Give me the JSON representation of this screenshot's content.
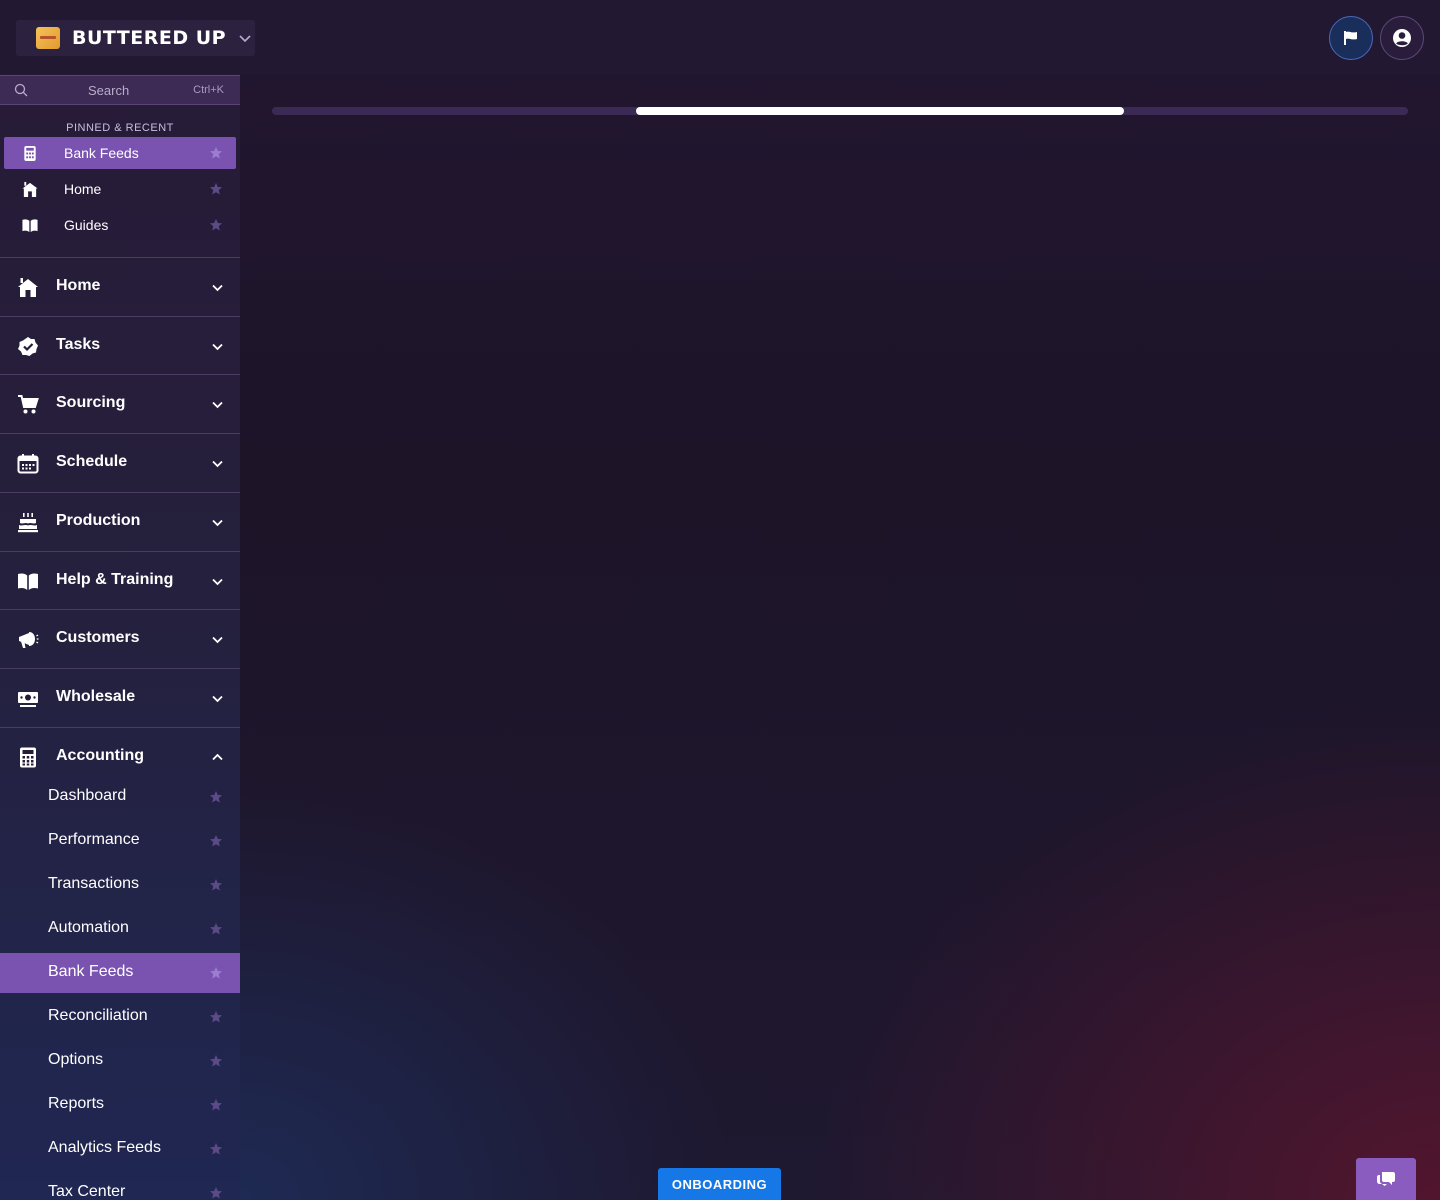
{
  "header": {
    "brand_name": "BUTTERED UP",
    "brand_logo": "buttered-up-logo",
    "flag_icon": "flag-icon",
    "user_icon": "user-circle-icon"
  },
  "sidebar": {
    "search": {
      "placeholder": "Search",
      "shortcut": "Ctrl+K"
    },
    "pinned_heading": "PINNED & RECENT",
    "pinned": [
      {
        "label": "Bank Feeds",
        "icon": "calculator-icon",
        "active": true
      },
      {
        "label": "Home",
        "icon": "home-icon",
        "active": false
      },
      {
        "label": "Guides",
        "icon": "book-icon",
        "active": false
      }
    ],
    "sections": [
      {
        "label": "Home",
        "icon": "home-icon",
        "expanded": false
      },
      {
        "label": "Tasks",
        "icon": "check-badge-icon",
        "expanded": false
      },
      {
        "label": "Sourcing",
        "icon": "cart-icon",
        "expanded": false
      },
      {
        "label": "Schedule",
        "icon": "calendar-icon",
        "expanded": false
      },
      {
        "label": "Production",
        "icon": "cake-icon",
        "expanded": false
      },
      {
        "label": "Help & Training",
        "icon": "book-icon",
        "expanded": false
      },
      {
        "label": "Customers",
        "icon": "megaphone-icon",
        "expanded": false
      },
      {
        "label": "Wholesale",
        "icon": "money-icon",
        "expanded": false
      },
      {
        "label": "Accounting",
        "icon": "calculator-icon",
        "expanded": true
      }
    ],
    "accounting_items": [
      {
        "label": "Dashboard",
        "active": false
      },
      {
        "label": "Performance",
        "active": false
      },
      {
        "label": "Transactions",
        "active": false
      },
      {
        "label": "Automation",
        "active": false
      },
      {
        "label": "Bank Feeds",
        "active": true
      },
      {
        "label": "Reconciliation",
        "active": false
      },
      {
        "label": "Options",
        "active": false
      },
      {
        "label": "Reports",
        "active": false
      },
      {
        "label": "Analytics Feeds",
        "active": false
      },
      {
        "label": "Tax Center",
        "active": false
      }
    ]
  },
  "main": {
    "loading_progress_segment": [
      0.32,
      0.75
    ]
  },
  "footer": {
    "onboarding_label": "ONBOARDING",
    "chat_icon": "chat-bubbles-icon"
  },
  "colors": {
    "accent_purple": "#7a53b0",
    "onboarding_blue": "#1677e6",
    "star_inactive": "#5b4a86"
  }
}
